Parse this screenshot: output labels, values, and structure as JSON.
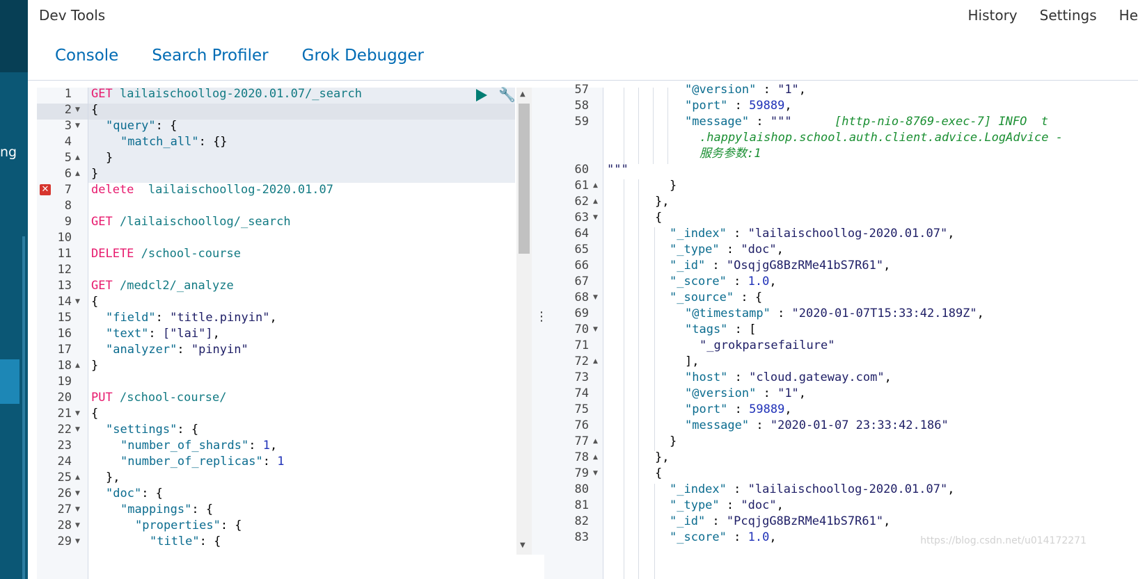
{
  "app": {
    "title": "Dev Tools"
  },
  "topnav": [
    "History",
    "Settings",
    "He"
  ],
  "sidebar": {
    "partial_label": "ng"
  },
  "tabs": [
    {
      "label": "Console",
      "active": true
    },
    {
      "label": "Search Profiler",
      "active": false
    },
    {
      "label": "Grok Debugger",
      "active": false
    }
  ],
  "editor": {
    "line_numbers": [
      "1",
      "2",
      "3",
      "4",
      "5",
      "6",
      "7",
      "8",
      "9",
      "10",
      "11",
      "12",
      "13",
      "14",
      "15",
      "16",
      "17",
      "18",
      "19",
      "20",
      "21",
      "22",
      "23",
      "24",
      "25",
      "26",
      "27",
      "28",
      "29"
    ],
    "lines": [
      {
        "method": "GET",
        "url": "lailaischoollog-2020.01.07/_search"
      },
      {
        "text": "{"
      },
      {
        "key": "\"query\"",
        "rest": ": {"
      },
      {
        "key": "\"match_all\"",
        "rest": ": {}"
      },
      {
        "text": "}"
      },
      {
        "text": "}"
      },
      {
        "method": "delete",
        "url": "lailaischoollog-2020.01.07"
      },
      {
        "text": ""
      },
      {
        "method": "GET",
        "url": "/lailaischoollog/_search"
      },
      {
        "text": ""
      },
      {
        "method": "DELETE",
        "url": "/school-course"
      },
      {
        "text": ""
      },
      {
        "method": "GET",
        "url": "/medcl2/_analyze"
      },
      {
        "text": "{"
      },
      {
        "key": "\"field\"",
        "str": "\"title.pinyin\"",
        "tail": ","
      },
      {
        "key": "\"text\"",
        "str": "[\"lai\"]",
        "tail": ","
      },
      {
        "key": "\"analyzer\"",
        "str": "\"pinyin\""
      },
      {
        "text": "}"
      },
      {
        "text": ""
      },
      {
        "method": "PUT",
        "url": "/school-course/"
      },
      {
        "text": "{"
      },
      {
        "key": "\"settings\"",
        "rest": ": {"
      },
      {
        "key": "\"number_of_shards\"",
        "num": "1",
        "tail": ","
      },
      {
        "key": "\"number_of_replicas\"",
        "num": "1"
      },
      {
        "text": "},"
      },
      {
        "key": "\"doc\"",
        "rest": ": {"
      },
      {
        "key": "\"mappings\"",
        "rest": ": {"
      },
      {
        "key": "\"properties\"",
        "rest": ": {"
      },
      {
        "key": "\"title\"",
        "rest": ": {"
      }
    ]
  },
  "output": {
    "line_numbers": [
      "57",
      "58",
      "59",
      "60",
      "61",
      "62",
      "63",
      "64",
      "65",
      "66",
      "67",
      "68",
      "69",
      "70",
      "71",
      "72",
      "73",
      "74",
      "75",
      "76",
      "77",
      "78",
      "79",
      "80",
      "81",
      "82",
      "83"
    ],
    "message_log": "      [http-nio-8769-exec-7] INFO  t",
    "message_log_2": ".happylaishop.school.auth.client.advice.LogAdvice -",
    "message_log_3": "服务参数:1",
    "triple_quote": "\"\"\"",
    "lines": {
      "version_key": "\"@version\"",
      "version_val": "\"1\"",
      "port_key": "\"port\"",
      "port_val": "59889",
      "message_key": "\"message\"",
      "index_key": "\"_index\"",
      "index_val": "\"lailaischoollog-2020.01.07\"",
      "type_key": "\"_type\"",
      "type_val": "\"doc\"",
      "id_key": "\"_id\"",
      "id_val_1": "\"OsqjgG8BzRMe41bS7R61\"",
      "id_val_2": "\"PcqjgG8BzRMe41bS7R61\"",
      "score_key": "\"_score\"",
      "score_val": "1.0",
      "source_key": "\"_source\"",
      "timestamp_key": "\"@timestamp\"",
      "timestamp_val": "\"2020-01-07T15:33:42.189Z\"",
      "tags_key": "\"tags\"",
      "tags_val": "\"_grokparsefailure\"",
      "host_key": "\"host\"",
      "host_val": "\"cloud.gateway.com\"",
      "message_val": "\"2020-01-07 23:33:42.186\""
    }
  },
  "watermark": "https://blog.csdn.net/u014172271"
}
